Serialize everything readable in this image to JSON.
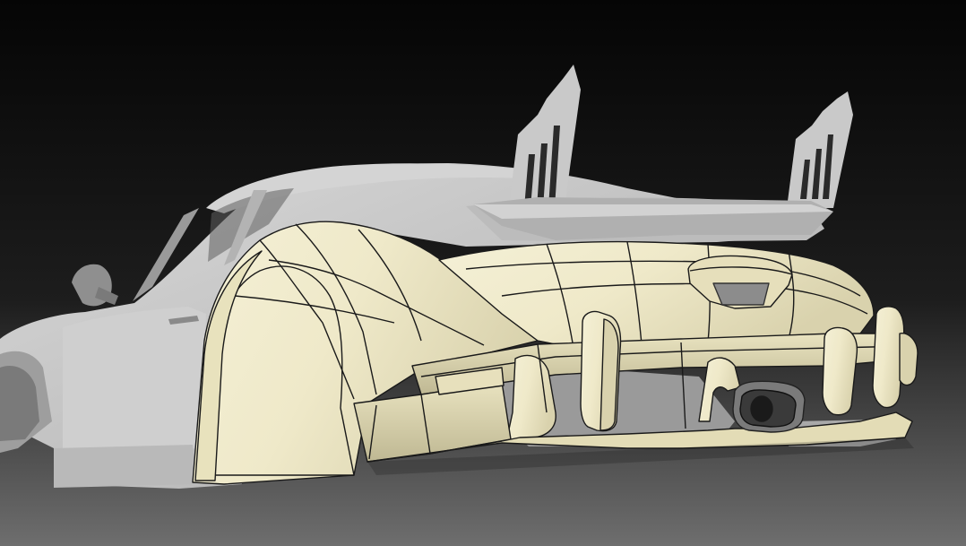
{
  "viewport": {
    "background_top": "#050505",
    "background_bottom": "#6e6e6e"
  },
  "scan_mesh": {
    "color": "#c8c8c8",
    "shadow_color": "#7d7d7d"
  },
  "surface_model": {
    "fill": "#ede8c8",
    "shade": "#cfc9a6",
    "edge": "#1a1a1a"
  }
}
